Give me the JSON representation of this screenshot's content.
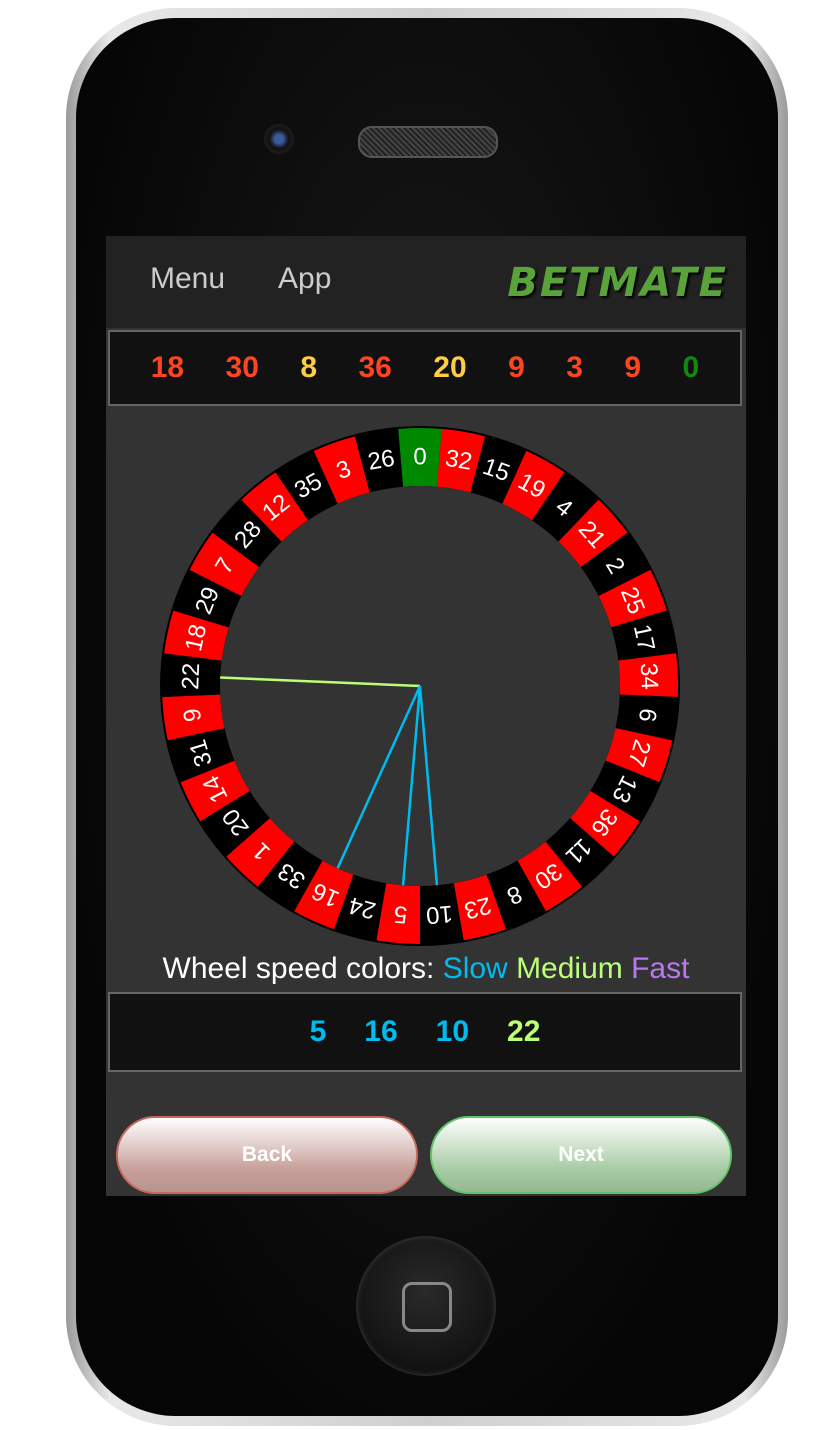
{
  "header": {
    "menu_label": "Menu",
    "app_label": "App",
    "logo_text": "BETMATE"
  },
  "history": [
    {
      "value": "18",
      "color": "#ff4422"
    },
    {
      "value": "30",
      "color": "#ff4422"
    },
    {
      "value": "8",
      "color": "#ffcc44"
    },
    {
      "value": "36",
      "color": "#ff4422"
    },
    {
      "value": "20",
      "color": "#ffcc44"
    },
    {
      "value": "9",
      "color": "#ff4422"
    },
    {
      "value": "3",
      "color": "#ff4422"
    },
    {
      "value": "9",
      "color": "#ff4422"
    },
    {
      "value": "0",
      "color": "#118811"
    }
  ],
  "wheel": {
    "order": [
      0,
      32,
      15,
      19,
      4,
      21,
      2,
      25,
      17,
      34,
      6,
      27,
      13,
      36,
      11,
      30,
      8,
      23,
      10,
      5,
      24,
      16,
      33,
      1,
      20,
      14,
      31,
      9,
      22,
      18,
      29,
      7,
      28,
      12,
      35,
      3,
      26
    ],
    "colors": {
      "red": "#ff0000",
      "black": "#000000",
      "green": "#008800"
    },
    "lines": [
      {
        "number": 22,
        "speed": "medium"
      },
      {
        "number": 16,
        "speed": "slow"
      },
      {
        "number": 5,
        "speed": "slow"
      },
      {
        "number": 10,
        "speed": "slow"
      }
    ]
  },
  "legend": {
    "label": "Wheel speed colors:",
    "slow": "Slow",
    "medium": "Medium",
    "fast": "Fast",
    "slow_color": "#00bbee",
    "medium_color": "#bbff77",
    "fast_color": "#bb77ee"
  },
  "speeds": [
    {
      "value": "5",
      "speed": "slow"
    },
    {
      "value": "16",
      "speed": "slow"
    },
    {
      "value": "10",
      "speed": "slow"
    },
    {
      "value": "22",
      "speed": "medium"
    }
  ],
  "buttons": {
    "back": "Back",
    "next": "Next"
  }
}
